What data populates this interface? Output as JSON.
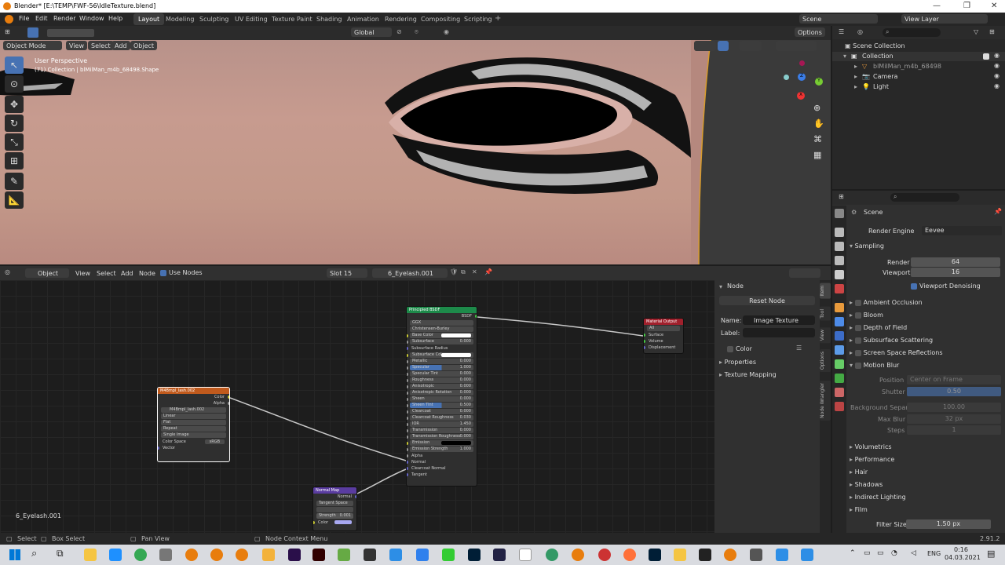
{
  "window": {
    "title": "Blender* [E:\\TEMP\\FWF-56\\IdleTexture.blend]"
  },
  "menu": [
    "File",
    "Edit",
    "Render",
    "Window",
    "Help"
  ],
  "workspaces": [
    "Layout",
    "Modeling",
    "Sculpting",
    "UV Editing",
    "Texture Paint",
    "Shading",
    "Animation",
    "Rendering",
    "Compositing",
    "Scripting"
  ],
  "scene_name": "Scene",
  "view_layer": "View Layer",
  "viewport": {
    "transform": "Global",
    "options": "Options",
    "mode": "Object Mode",
    "menu": [
      "View",
      "Select",
      "Add",
      "Object"
    ],
    "overlay_title": "User Perspective",
    "overlay_sub": "(71) Collection | blMilMan_m4b_68498.Shape",
    "gizmo_axes": [
      "Y",
      "Z",
      "X"
    ]
  },
  "node_editor": {
    "type": "Object",
    "menu": [
      "View",
      "Select",
      "Add",
      "Node"
    ],
    "use_nodes": "Use Nodes",
    "slot": "Slot 15",
    "material": "6_Eyelash.001",
    "footer_name": "6_Eyelash.001",
    "principled": {
      "title": "Principled BSDF",
      "output": "BSDF",
      "dist": "GGX",
      "subsurf": "Christensen-Burley",
      "rows": [
        {
          "label": "Base Color",
          "value": ""
        },
        {
          "label": "Subsurface",
          "value": "0.000"
        },
        {
          "label": "Subsurface Radius",
          "value": ""
        },
        {
          "label": "Subsurface Color",
          "value": ""
        },
        {
          "label": "Metallic",
          "value": "0.000"
        },
        {
          "label": "Specular",
          "value": "1.000"
        },
        {
          "label": "Specular Tint",
          "value": "0.000"
        },
        {
          "label": "Roughness",
          "value": "0.000"
        },
        {
          "label": "Anisotropic",
          "value": "0.000"
        },
        {
          "label": "Anisotropic Rotation",
          "value": "0.000"
        },
        {
          "label": "Sheen",
          "value": "0.000"
        },
        {
          "label": "Sheen Tint",
          "value": "0.500"
        },
        {
          "label": "Clearcoat",
          "value": "0.000"
        },
        {
          "label": "Clearcoat Roughness",
          "value": "0.030"
        },
        {
          "label": "IOR",
          "value": "1.450"
        },
        {
          "label": "Transmission",
          "value": "0.000"
        },
        {
          "label": "Transmission Roughness",
          "value": "0.000"
        },
        {
          "label": "Emission",
          "value": ""
        },
        {
          "label": "Emission Strength",
          "value": "1.000"
        },
        {
          "label": "Alpha",
          "value": ""
        },
        {
          "label": "Normal",
          "value": ""
        },
        {
          "label": "Clearcoat Normal",
          "value": ""
        },
        {
          "label": "Tangent",
          "value": ""
        }
      ]
    },
    "material_output": {
      "title": "Material Output",
      "target": "All",
      "inputs": [
        "Surface",
        "Volume",
        "Displacement"
      ]
    },
    "image_texture": {
      "title": "M4Bmpl_lash.002",
      "outputs": [
        "Color",
        "Alpha"
      ],
      "image": "M4Bmpl_lash.002",
      "fields": [
        "Linear",
        "Flat",
        "Repeat",
        "Single Image"
      ],
      "color_space_label": "Color Space",
      "color_space": "sRGB",
      "vector": "Vector"
    },
    "normal_map": {
      "title": "Normal Map",
      "output": "Normal",
      "space": "Tangent Space",
      "strength_label": "Strength",
      "strength": "0.001",
      "color": "Color"
    },
    "side_panel": {
      "header": "Node",
      "reset": "Reset Node",
      "name_label": "Name:",
      "name_value": "Image Texture",
      "label_label": "Label:",
      "color": "Color",
      "properties": "Properties",
      "texture_mapping": "Texture Mapping",
      "tabs": [
        "Item",
        "Tool",
        "View",
        "Options",
        "Node Wrangler"
      ]
    }
  },
  "outliner": {
    "root": "Scene Collection",
    "items": [
      {
        "label": "Collection",
        "depth": 1
      },
      {
        "label": "blMilMan_m4b_68498",
        "depth": 2
      },
      {
        "label": "Camera",
        "depth": 2
      },
      {
        "label": "Light",
        "depth": 2
      }
    ]
  },
  "properties": {
    "scene": "Scene",
    "render_engine_label": "Render Engine",
    "render_engine": "Eevee",
    "sampling": "Sampling",
    "render_label": "Render",
    "render_value": "64",
    "viewport_label": "Viewport",
    "viewport_value": "16",
    "denoise": "Viewport Denoising",
    "sections_a": [
      "Ambient Occlusion",
      "Bloom",
      "Depth of Field",
      "Subsurface Scattering",
      "Screen Space Reflections"
    ],
    "motion_blur": "Motion Blur",
    "mb_position_label": "Position",
    "mb_position": "Center on Frame",
    "mb_shutter_label": "Shutter",
    "mb_shutter": "0.50",
    "mb_bg_label": "Background Separ...",
    "mb_bg": "100.00",
    "mb_max_label": "Max Blur",
    "mb_max": "32 px",
    "mb_steps_label": "Steps",
    "mb_steps": "1",
    "sections_b": [
      "Volumetrics",
      "Performance",
      "Hair",
      "Shadows",
      "Indirect Lighting",
      "Film"
    ],
    "filter_label": "Filter Size",
    "filter_value": "1.50 px"
  },
  "status": {
    "select": "Select",
    "box": "Box Select",
    "pan": "Pan View",
    "ctx": "Node Context Menu",
    "version": "2.91.2"
  },
  "taskbar": {
    "time": "0:16",
    "date": "04.03.2021",
    "lang": "ENG",
    "icons": [
      "search-icon",
      "task-view-icon",
      "windows-icon",
      "edge-icon",
      "chrome-icon",
      "blender-icon",
      "daz-icon",
      "after-effects-icon",
      "illustrator-icon",
      "vscode-icon",
      "photoshop-icon",
      "lightroom-icon",
      "firefox-icon",
      "folder-icon"
    ]
  }
}
